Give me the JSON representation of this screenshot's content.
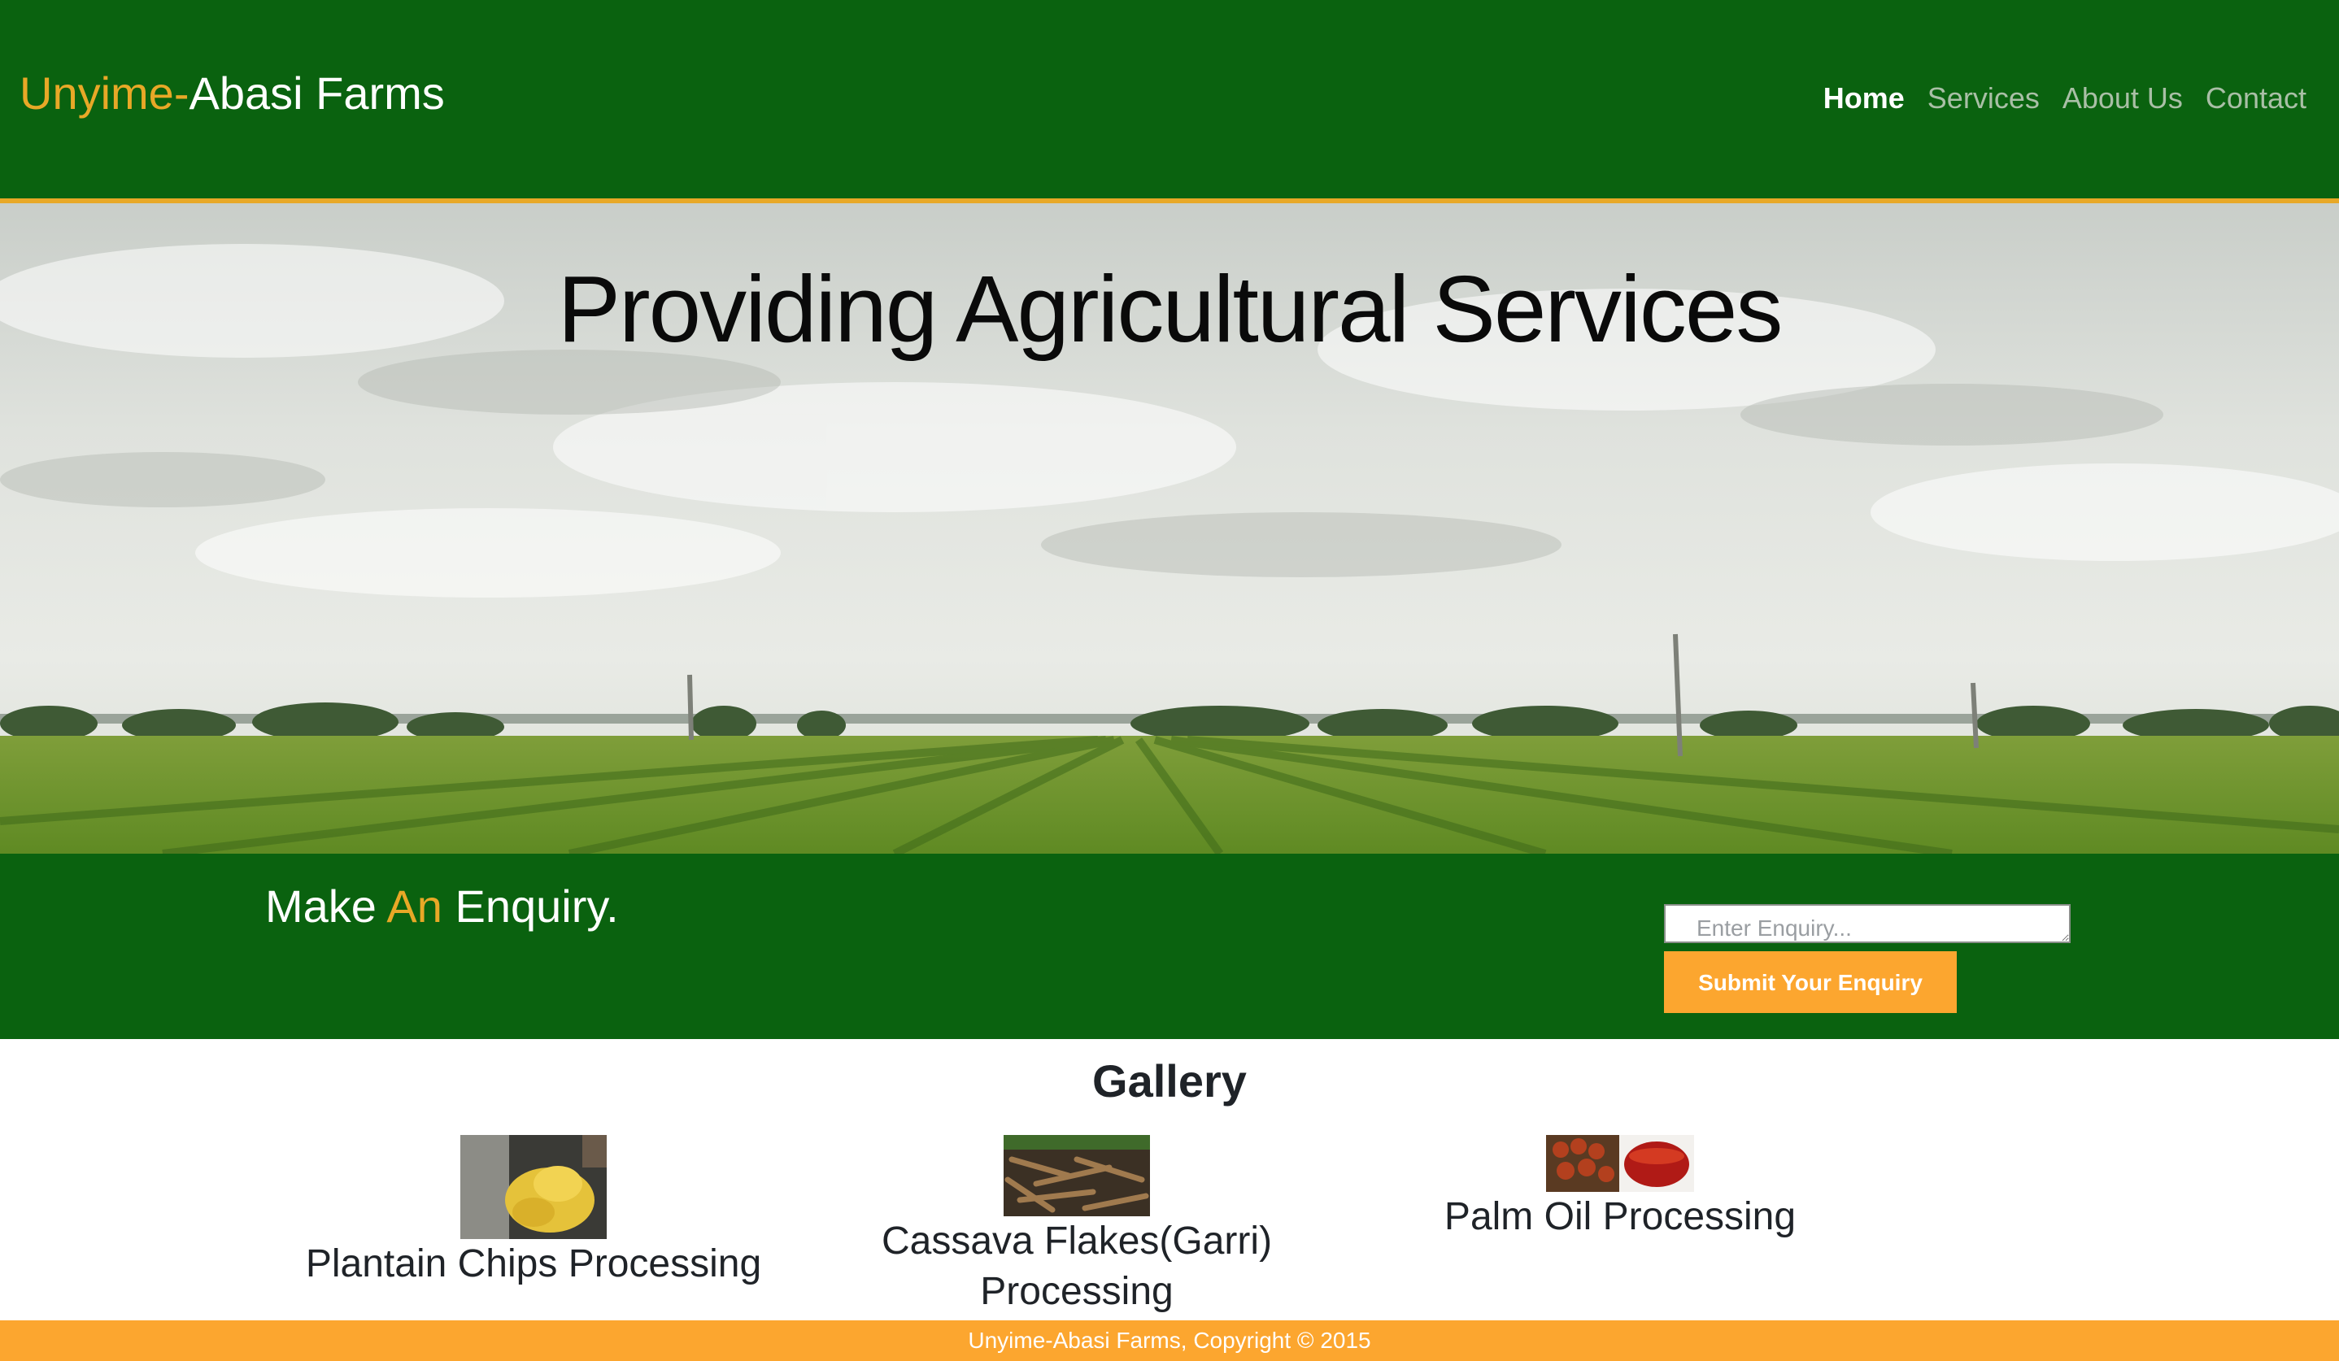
{
  "header": {
    "brand_first": "Unyime-",
    "brand_second": "Abasi Farms",
    "nav": [
      "Home",
      "Services",
      "About Us",
      "Contact"
    ]
  },
  "hero": {
    "title": "Providing Agricultural Services"
  },
  "enquiry": {
    "title_part1": "Make ",
    "title_accent": "An",
    "title_part2": " Enquiry.",
    "input_placeholder": "Enter Enquiry...",
    "submit_label": "Submit Your Enquiry"
  },
  "gallery": {
    "title": "Gallery",
    "items": [
      {
        "caption": "Plantain Chips Processing"
      },
      {
        "caption": "Cassava Flakes(Garri) Processing"
      },
      {
        "caption": "Palm Oil Processing"
      }
    ]
  },
  "footer": {
    "text": "Unyime-Abasi Farms, Copyright © 2015"
  },
  "colors": {
    "header_green": "#0a620f",
    "accent_gold": "#e8a827",
    "button_orange": "#fca62f"
  }
}
